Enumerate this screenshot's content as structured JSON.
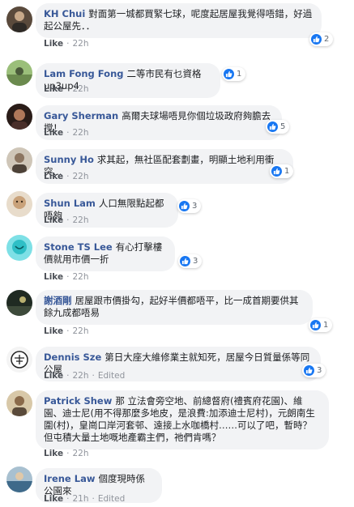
{
  "actions": {
    "like_label": "Like",
    "separator": "·",
    "edited_label": "Edited"
  },
  "comments": [
    {
      "author": "KH Chui",
      "text": "對面第一城都買緊七球，呢度起居屋我覺得唔錯，好過起公屋先．．",
      "reactions": "2",
      "time": "22h",
      "edited": false,
      "avatar_color": "#5a4a3c"
    },
    {
      "author": "Lam Fong Fong",
      "text": "二等市民有乜資格up3up4",
      "reactions": "1",
      "time": "22h",
      "edited": false,
      "avatar_color": "#6b8a4e"
    },
    {
      "author": "Gary Sherman",
      "text": "高爾夫球場唔見你個垃圾政府夠膽去搅！",
      "reactions": "5",
      "time": "22h",
      "edited": false,
      "avatar_color": "#4a2f2a"
    },
    {
      "author": "Sunny Ho",
      "text": "求其起，無社區配套劃畫，明顯土地利用衝突...",
      "reactions": "1",
      "time": "22h",
      "edited": false,
      "avatar_color": "#7a6c5c"
    },
    {
      "author": "Shun Lam",
      "text": "人口無限點起都唔夠",
      "reactions": "3",
      "time": "22h",
      "edited": false,
      "avatar_color": "#c9a27a"
    },
    {
      "author": "Stone TS Lee",
      "text": "有心打擊樓價就用市價一折",
      "reactions": "3",
      "time": "22h",
      "edited": false,
      "avatar_color": "#2fbfc6"
    },
    {
      "author": "謝酒剛",
      "text": "居屋跟市價掛勾，起好半價都唔平，比一成首期要供其餘九成都唔易",
      "reactions": "1",
      "time": "22h",
      "edited": false,
      "avatar_color": "#3d4a3a"
    },
    {
      "author": "Dennis Sze",
      "text": "第日大座大維修業主就知死，居屋今日質量係等同公屋",
      "reactions": "3",
      "time": "22h",
      "edited": true,
      "avatar_color": "#e8e8e8"
    },
    {
      "author": "Patrick Shew",
      "text": "那 立法會旁空地、前總督府(禮賓府花園)、維園、迪士尼(用不得那麼多地皮，是浪費:加添迪士尼村)，元朗南生圍(村)，皇崗口岸河套邨、遠接上水咖橋村……可以了吧，暫時？但屯積大量土地嘅地產霸主們，祂們肯嗎？",
      "reactions": "",
      "time": "22h",
      "edited": false,
      "avatar_color": "#8a6a4a"
    },
    {
      "author": "Irene Law",
      "text": "個度現時係公園來",
      "reactions": "",
      "time": "21h",
      "edited": true,
      "avatar_color": "#3f6a8a"
    }
  ],
  "icons": {
    "like": "thumbs-up-icon",
    "avatar": "user-avatar"
  }
}
